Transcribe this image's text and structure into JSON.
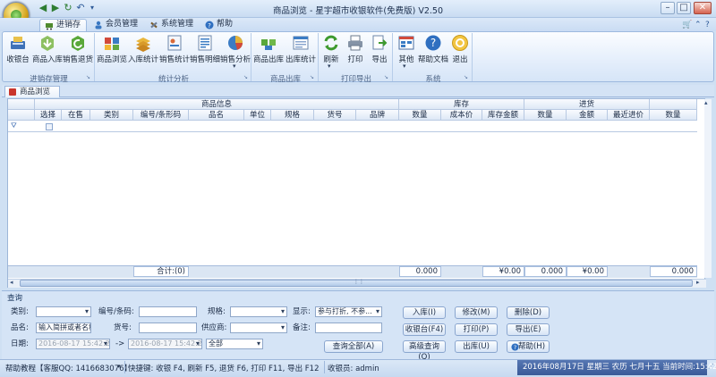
{
  "window": {
    "title": "商品浏览 - 星宇超市收银软件(免费版) V2.50"
  },
  "quick_access": [
    "back",
    "forward",
    "refresh",
    "undo"
  ],
  "tabs": [
    {
      "label": "进销存",
      "active": true
    },
    {
      "label": "会员管理",
      "active": false
    },
    {
      "label": "系统管理",
      "active": false
    },
    {
      "label": "帮助",
      "active": false
    }
  ],
  "ribbon": {
    "groups": [
      {
        "label": "进销存管理",
        "buttons": [
          "收银台",
          "商品入库",
          "销售退货"
        ]
      },
      {
        "label": "统计分析",
        "buttons": [
          "商品浏览",
          "入库统计",
          "销售统计",
          "销售明细",
          "销售分析"
        ]
      },
      {
        "label": "商品出库",
        "buttons": [
          "商品出库",
          "出库统计"
        ]
      },
      {
        "label": "打印导出",
        "buttons": [
          "刷新",
          "打印",
          "导出"
        ]
      },
      {
        "label": "系统",
        "buttons": [
          "其他",
          "帮助文档",
          "退出"
        ]
      }
    ]
  },
  "doc_tab": "商品浏览",
  "grid": {
    "groups": [
      "商品信息",
      "库存",
      "进货"
    ],
    "columns": [
      "选择",
      "在售",
      "类别",
      "编号/条形码",
      "品名",
      "单位",
      "规格",
      "货号",
      "品牌",
      "数量",
      "成本价",
      "库存金额",
      "数量",
      "金额",
      "最近进价",
      "数量"
    ],
    "footer": {
      "count_label": "合计:(0)",
      "stock_qty": "0.000",
      "stock_amount": "¥0.00",
      "purchase_qty": "0.000",
      "purchase_amount": "¥0.00",
      "last_qty": "0.000"
    }
  },
  "query": {
    "title": "查询",
    "category_label": "类别:",
    "code_label": "编号/条码:",
    "spec_label": "规格:",
    "display_label": "显示:",
    "display_value": "参与打折, 不参...",
    "name_label": "品名:",
    "name_placeholder": "输入简拼或者名称",
    "item_no_label": "货号:",
    "supplier_label": "供应商:",
    "remark_label": "备注:",
    "date_label": "日期:",
    "date_from": "2016-08-17 15:42:27",
    "arrow": "->",
    "date_to": "2016-08-17 15:42:27",
    "date_range": "全部",
    "query_all_button": "查询全部(A)",
    "buttons": {
      "in": "入库(I)",
      "edit": "修改(M)",
      "delete": "删除(D)",
      "cashier": "收银台(F4)",
      "print": "打印(P)",
      "export": "导出(E)",
      "advanced": "高级查询(Q)",
      "out": "出库(U)",
      "help": "帮助(H)"
    }
  },
  "status": {
    "help": "帮助教程【客服QQ: 1416683076】",
    "shortcuts": "快捷键: 收银 F4, 刷新 F5, 退货 F6, 打印 F11, 导出 F12",
    "cashier": "收银员: admin",
    "datetime": "2016年08月17日 星期三 农历 七月十五 当前时间:15:42:33"
  },
  "colors": {
    "accent": "#3a5a98",
    "ribbon_bg": "#e4eefb",
    "window_bg": "#cfe0f3"
  }
}
